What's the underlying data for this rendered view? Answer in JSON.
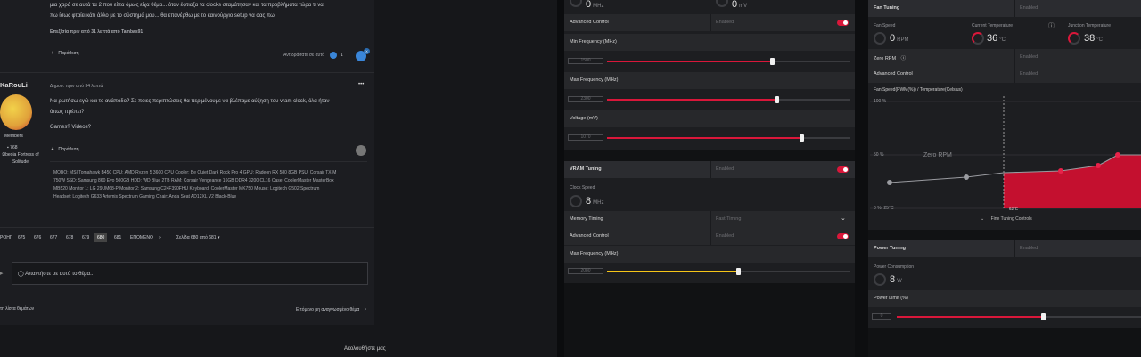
{
  "forum": {
    "prev_post_text_1": "μια χαρά σε αυτά τα 2 που είπα όμως είχα θέμα... όταν έφτιαξα τα clocks σταμάτησαν και τα προβλήματα τώρα τι να",
    "prev_post_text_2": "πω ίσως φταίει κάτι άλλο με το σύστημά μου... θα επανέρθω με το καινούργιο setup να σας πω",
    "edited_note": "Επεξ/σία πριν από 31 λεπτά από Tambas91",
    "follow_label": "Παράθεση",
    "reacted_label": "Αντιδράσατε σε αυτό",
    "reaction_count": "1",
    "reaction_badge": "X",
    "author_name": "KaRouLi",
    "author_role": "Members",
    "author_posts": "768",
    "author_location": "Ωbeoia Fortress of Solitude",
    "posted_time": "Δημοσ. πριν από 34 λεπτά",
    "post_more": "•••",
    "post_line_1": "Να ρωτήσω εγώ και το ανάποδο? Σε ποιες περιπτώσεις θα περιμένουμε να βλέπαμε αύξηση του vram clock, όλα ήταν",
    "post_line_2": "όπως πρέπει?",
    "post_line_3": "Games? Videos?",
    "quote_label": "Παράθεση",
    "sig_line_1": "MOBO: MSI Tomahawk B450 CPU: AMD Ryzen 5 3600 CPU Cooler: Be Quiet Dark Rock Pro 4 GPU: Radeon RX 580 8GB PSU: Corsair TX-M",
    "sig_line_2": "750W SSD: Samsung 860 Evo 500GB HDD: WD Blue 2TB RAM: Corsair Vengeance 16GB DDR4 3200 CL16 Case: CoolerMaster MasterBox",
    "sig_line_3": "MB520 Monitor 1: LG 29UM68-P Monitor 2: Samsung C24F390FHU Keyboard: CoolerMaster MK750 Mouse: Logitech G502 Spectrum",
    "sig_line_4": "Headset: Logitech G633 Artemis Spectrum Gaming Chair: Anda Seat AD12XL V2 Black-Blue",
    "pagination": [
      "ΡΟΗΓ",
      "675",
      "676",
      "677",
      "678",
      "679",
      "680",
      "681",
      "ΕΠΟΜΕΝΟ",
      "»"
    ],
    "page_info": "Σελίδα 680 από 681",
    "reply_placeholder": "Απαντήστε σε αυτό το θέμα...",
    "back_to_list": "τη λίστα θεμάτων",
    "next_unread": "Επόμενο μη αναγνωσμένο θέμα",
    "follow_us": "Ακολουθήστε μας"
  },
  "gpu_tuning": {
    "top_val_1": "0",
    "top_unit_1": "MHz",
    "top_val_2": "0",
    "top_unit_2": "mV",
    "advanced_control_label": "Advanced Control",
    "advanced_control_val": "Enabled",
    "min_freq_label": "Min Frequency (MHz)",
    "min_freq_value": "1500",
    "max_freq_label": "Max Frequency (MHz)",
    "max_freq_value": "2300",
    "voltage_label": "Voltage (mV)",
    "voltage_value": "1070"
  },
  "vram_tuning": {
    "title": "VRAM Tuning",
    "state": "Enabled",
    "clock_speed_label": "Clock Speed",
    "clock_speed_value": "8",
    "clock_speed_unit": "MHz",
    "memory_timing_label": "Memory Timing",
    "memory_timing_value": "Fast Timing",
    "advanced_control_label": "Advanced Control",
    "advanced_control_val": "Enabled",
    "max_freq_label": "Max Frequency (MHz)",
    "max_freq_value": "2080"
  },
  "fan_tuning": {
    "title": "Fan Tuning",
    "state": "Enabled",
    "fan_speed_label": "Fan Speed",
    "fan_speed_value": "0",
    "fan_speed_unit": "RPM",
    "current_temp_label": "Current Temperature",
    "current_temp_value": "36",
    "current_temp_unit": "°C",
    "junction_temp_label": "Junction Temperature",
    "junction_temp_value": "38",
    "junction_temp_unit": "°C",
    "zero_rpm_label": "Zero RPM",
    "zero_rpm_val": "Enabled",
    "advanced_control_label": "Advanced Control",
    "advanced_control_val": "Enabled",
    "curve_label": "Fan Speed(PWM(%)) / Temperature(Celsius)",
    "y_top": "100 %",
    "y_mid": "50 %",
    "y_bottom": "0 %, 25°C",
    "zero_rpm_zone": "Zero RPM",
    "marker_temp": "62°C",
    "fine_tuning": "Fine Tuning Controls"
  },
  "power_tuning": {
    "title": "Power Tuning",
    "state": "Enabled",
    "consumption_label": "Power Consumption",
    "consumption_value": "8",
    "consumption_unit": "W",
    "limit_label": "Power Limit (%)",
    "limit_value": "0"
  },
  "colors": {
    "accent_red": "#d9173a",
    "accent_yellow": "#f5c518",
    "forum_link_blue": "#3a86d9"
  },
  "slider_levels": {
    "gpu_min_freq": 0.68,
    "gpu_max_freq": 0.7,
    "gpu_voltage": 0.8,
    "vram_max_freq": 0.54,
    "power_limit": 0.6
  }
}
